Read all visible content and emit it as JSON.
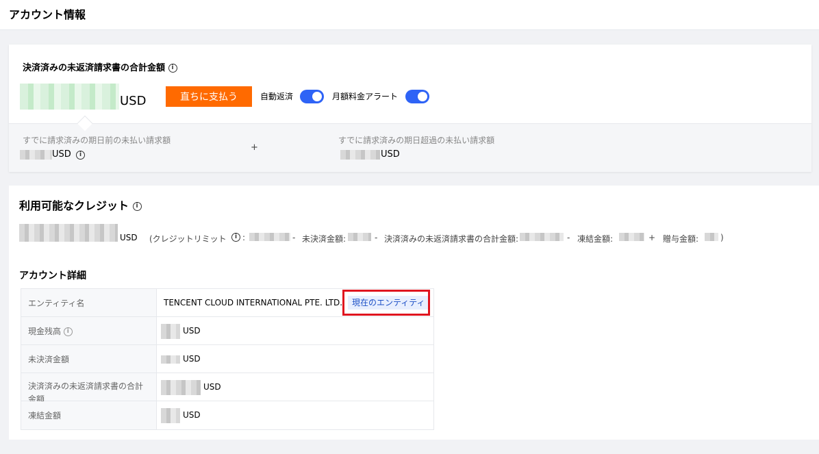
{
  "page": {
    "title": "アカウント情報"
  },
  "billing": {
    "title": "決済済みの未返済請求書の合計金額",
    "currency": "USD",
    "pay_button": "直ちに支払う",
    "auto_repay_label": "自動返済",
    "monthly_alert_label": "月額料金アラート",
    "before_due_label": "すでに請求済みの期日前の未払い請求額",
    "before_due_currency": "USD",
    "plus": "+",
    "overdue_label": "すでに請求済みの期日超過の未払い請求額",
    "overdue_currency": "USD"
  },
  "credit": {
    "title": "利用可能なクレジット",
    "currency": "USD",
    "breakdown_open": "(クレジットリミット",
    "colon": ":",
    "minus1": "-",
    "unsettled_label": "未決済金額:",
    "minus2": "-",
    "settled_label": "決済済みの未返済請求書の合計金額:",
    "minus3": "-",
    "frozen_label": "凍結金額:",
    "plus": "+",
    "gift_label": "贈与金額:",
    "breakdown_close": ")"
  },
  "details": {
    "title": "アカウント詳細",
    "rows": [
      {
        "label": "エンティティ名",
        "value": "TENCENT CLOUD INTERNATIONAL PTE. LTD.",
        "tag": "現在のエンティティ"
      },
      {
        "label": "現金残高",
        "value": "USD"
      },
      {
        "label": "未決済金額",
        "value": "USD"
      },
      {
        "label": "決済済みの未返済請求書の合計金額",
        "value": "USD"
      },
      {
        "label": "凍結金額",
        "value": "USD"
      }
    ]
  },
  "colors": {
    "accent": "#ff6a00",
    "toggle": "#2e63f6",
    "highlight": "#e0151f"
  }
}
